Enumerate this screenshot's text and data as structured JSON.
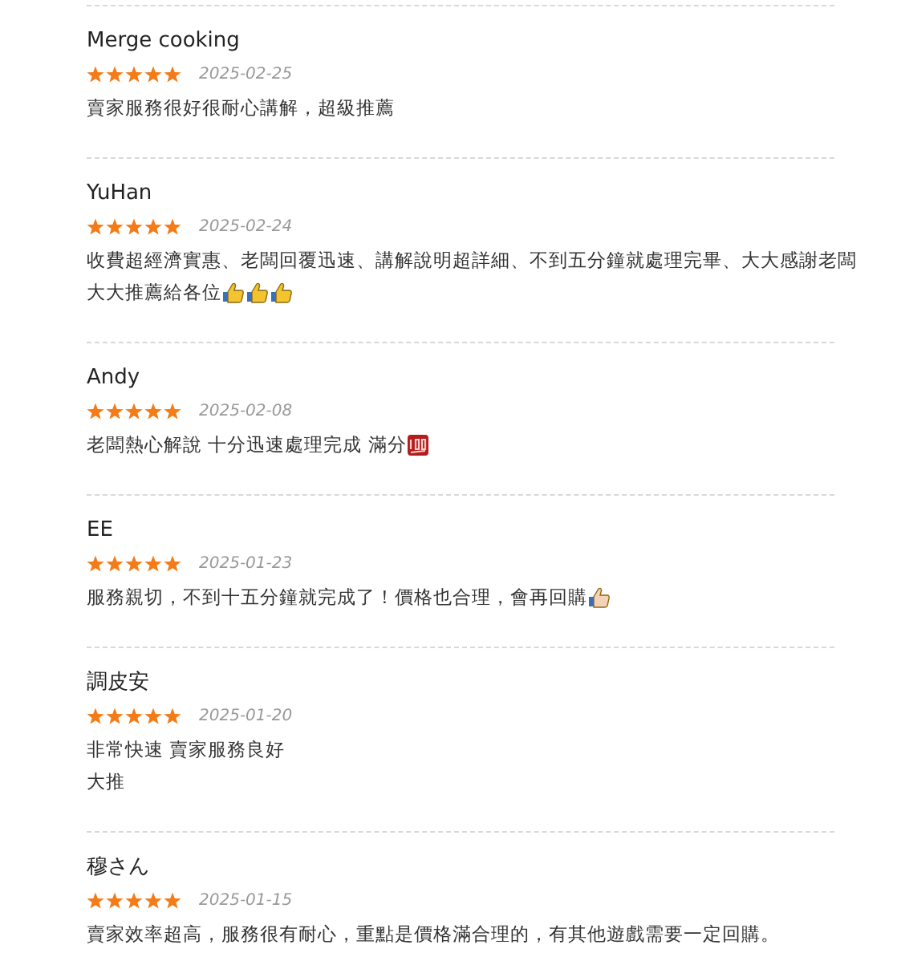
{
  "reviews": [
    {
      "name": "Merge cooking",
      "stars": 5,
      "date": "2025-02-25",
      "lines": [
        {
          "text": "賣家服務很好很耐心講解，超級推薦"
        }
      ]
    },
    {
      "name": "YuHan",
      "stars": 5,
      "date": "2025-02-24",
      "lines": [
        {
          "text": "收費超經濟實惠、老闆回覆迅速、講解說明超詳細、不到五分鐘就處理完畢、大大感謝老闆"
        },
        {
          "text": "大大推薦給各位",
          "emojis": [
            {
              "kind": "thumb"
            },
            {
              "kind": "thumb"
            },
            {
              "kind": "thumb"
            }
          ]
        }
      ]
    },
    {
      "name": "Andy",
      "stars": 5,
      "date": "2025-02-08",
      "lines": [
        {
          "text": "老闆熱心解說 十分迅速處理完成 滿分",
          "emojis": [
            {
              "kind": "hundred"
            }
          ]
        }
      ]
    },
    {
      "name": "EE",
      "stars": 5,
      "date": "2025-01-23",
      "lines": [
        {
          "text": "服務親切，不到十五分鐘就完成了！價格也合理，會再回購",
          "emojis": [
            {
              "kind": "thumb-light"
            }
          ]
        }
      ]
    },
    {
      "name": "調皮安",
      "stars": 5,
      "date": "2025-01-20",
      "lines": [
        {
          "text": "非常快速 賣家服務良好"
        },
        {
          "text": "大推"
        }
      ]
    },
    {
      "name": "穆さん",
      "stars": 5,
      "date": "2025-01-15",
      "lines": [
        {
          "text": "賣家效率超高，服務很有耐心，重點是價格滿合理的，有其他遊戲需要一定回購。"
        }
      ]
    }
  ]
}
